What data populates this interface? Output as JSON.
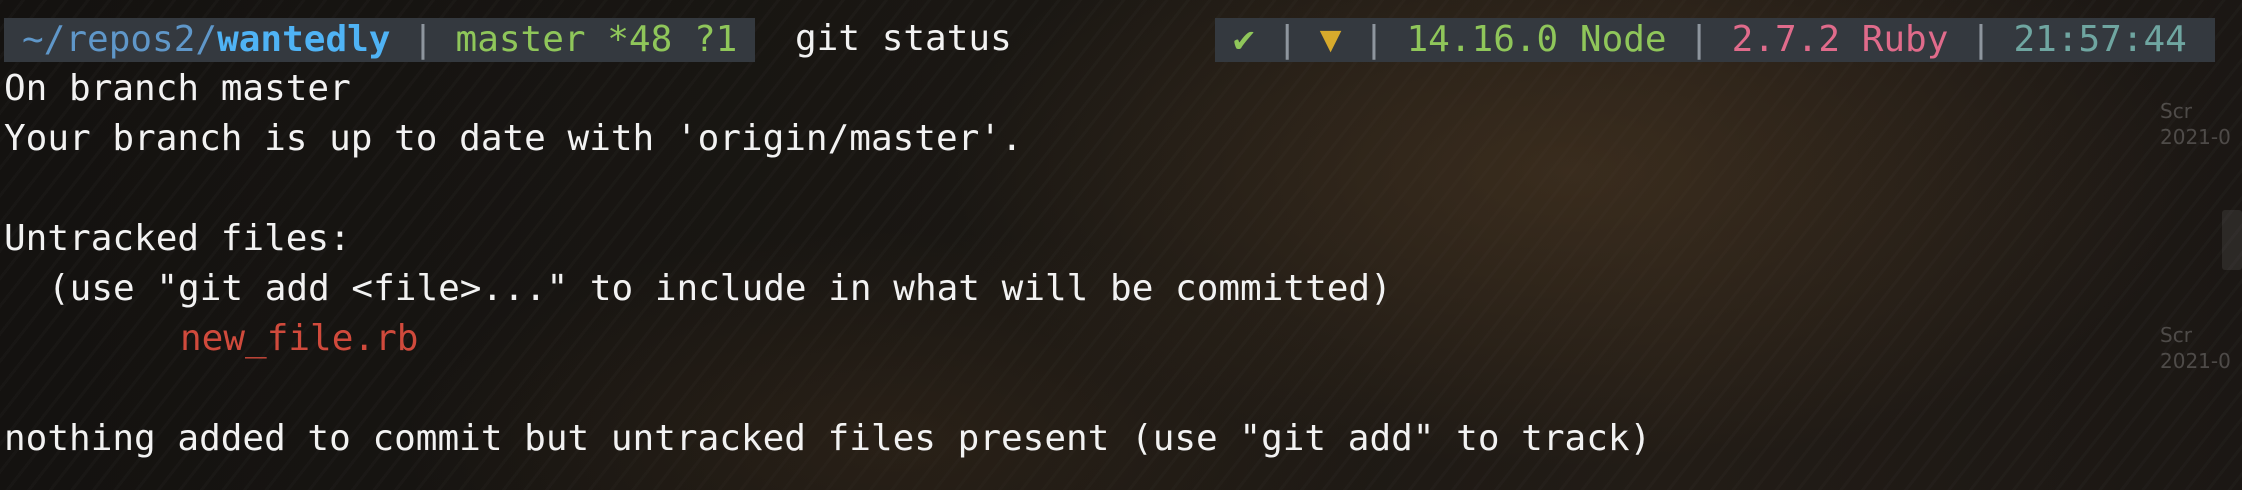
{
  "prompt": {
    "cwd_prefix": "~/repos2/",
    "cwd_repo": "wantedly",
    "separator": "|",
    "git_status": "master *48 ?1",
    "command": "git status",
    "right": {
      "status_ok": "✔",
      "arrow": "▼",
      "node": "14.16.0 Node",
      "ruby": "2.7.2 Ruby",
      "time": "21:57:44"
    }
  },
  "output": {
    "line1": "On branch master",
    "line2": "Your branch is up to date with 'origin/master'.",
    "line3": "",
    "line4": "Untracked files:",
    "line5": "(use \"git add <file>...\" to include in what will be committed)",
    "line6": "new_file.rb",
    "line7": "",
    "line8": "nothing added to commit but untracked files present (use \"git add\" to track)"
  },
  "desktop": {
    "hint1a": "Scr",
    "hint1b": "2021-0",
    "hint2a": "Scr",
    "hint2b": "2021-0"
  },
  "colors": {
    "cwd_repo": "#4fb3f5",
    "git_branch": "#8fc65a",
    "ruby": "#e06b8b",
    "time": "#6fa6a1",
    "untracked_file": "#d04a3c",
    "prompt_bg": "#34393f"
  }
}
